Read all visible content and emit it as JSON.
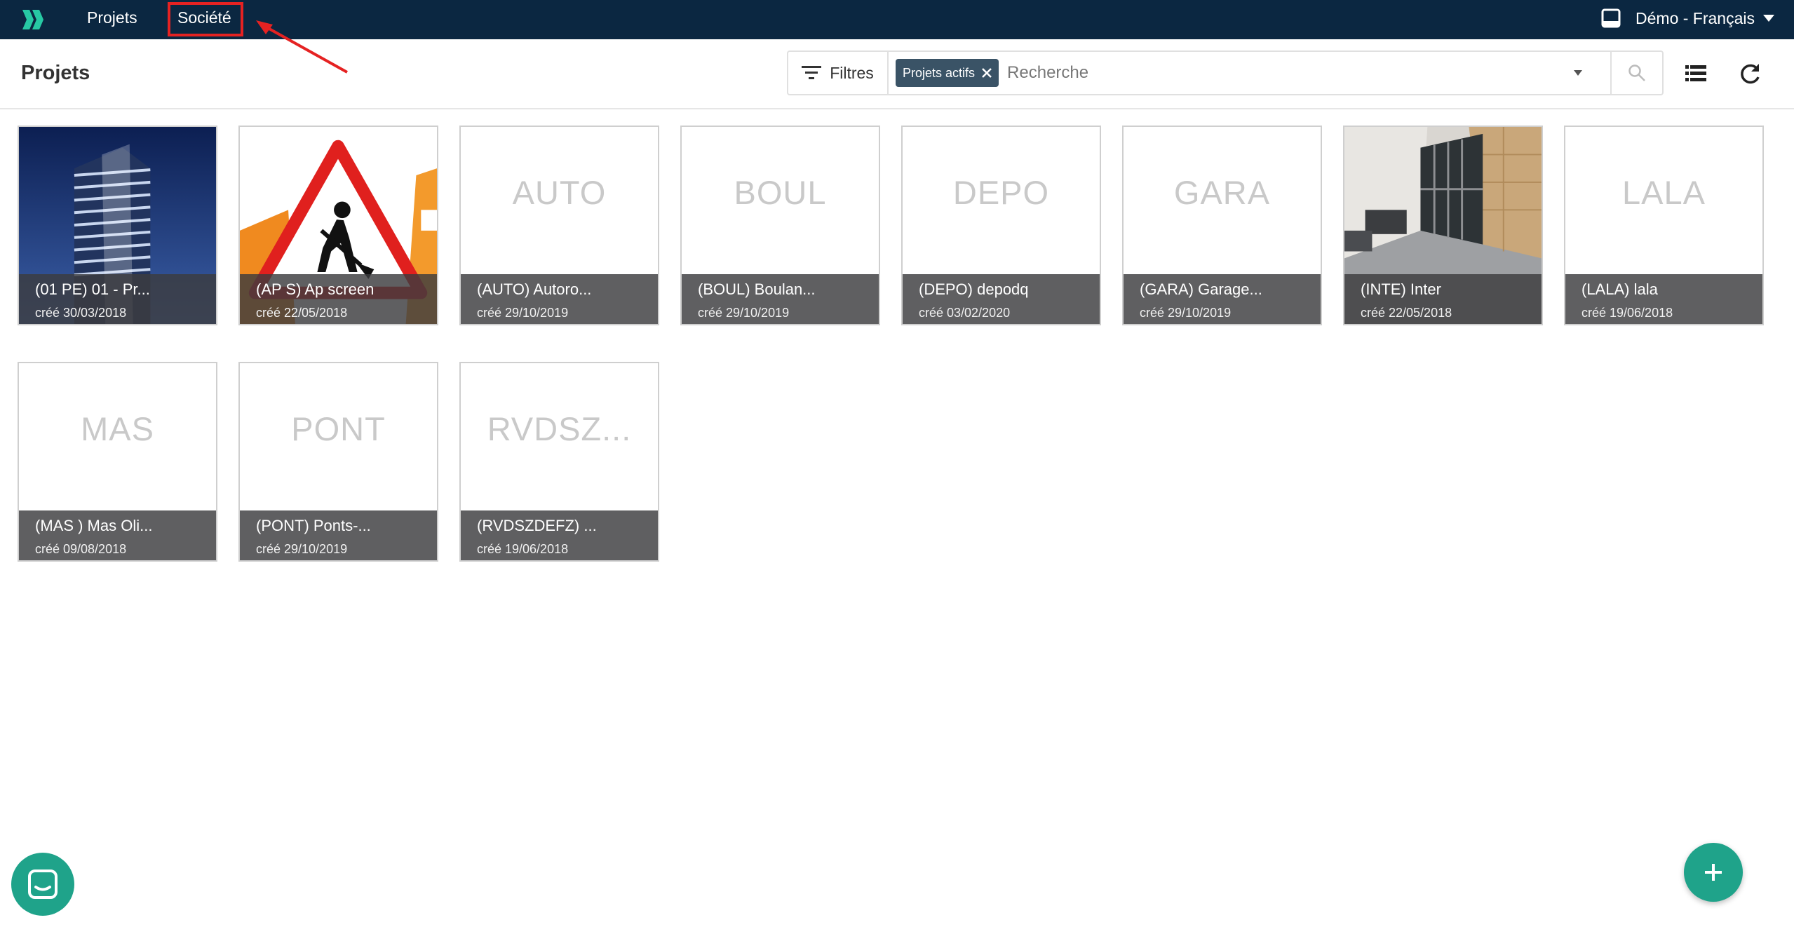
{
  "nav": {
    "items": [
      {
        "label": "Projets"
      },
      {
        "label": "Société"
      }
    ],
    "user_label": "Démo - Français"
  },
  "toolbar": {
    "title": "Projets",
    "filter_label": "Filtres",
    "chip_label": "Projets actifs",
    "search_placeholder": "Recherche"
  },
  "projects": [
    {
      "code": "",
      "title": "(01 PE) 01 - Pr...",
      "date": "créé 30/03/2018",
      "image": "building-photo"
    },
    {
      "code": "",
      "title": "(AP S) Ap screen",
      "date": "créé 22/05/2018",
      "image": "roadwork-sign"
    },
    {
      "code": "AUTO",
      "title": "(AUTO) Autoro...",
      "date": "créé 29/10/2019",
      "image": ""
    },
    {
      "code": "BOUL",
      "title": "(BOUL) Boulan...",
      "date": "créé 29/10/2019",
      "image": ""
    },
    {
      "code": "DEPO",
      "title": "(DEPO) depodq",
      "date": "créé 03/02/2020",
      "image": ""
    },
    {
      "code": "GARA",
      "title": "(GARA) Garage...",
      "date": "créé 29/10/2019",
      "image": ""
    },
    {
      "code": "",
      "title": "(INTE) Inter",
      "date": "créé 22/05/2018",
      "image": "interior-photo"
    },
    {
      "code": "LALA",
      "title": "(LALA) lala",
      "date": "créé 19/06/2018",
      "image": ""
    },
    {
      "code": "MAS",
      "title": "(MAS ) Mas Oli...",
      "date": "créé 09/08/2018",
      "image": ""
    },
    {
      "code": "PONT",
      "title": "(PONT) Ponts-...",
      "date": "créé 29/10/2019",
      "image": ""
    },
    {
      "code": "RVDSZ...",
      "title": "(RVDSZDEFZ) ...",
      "date": "créé 19/06/2018",
      "image": ""
    }
  ],
  "colors": {
    "navbar": "#0b2741",
    "accent": "#1fa38a",
    "chip": "#3a5366",
    "annotation": "#e52222"
  }
}
